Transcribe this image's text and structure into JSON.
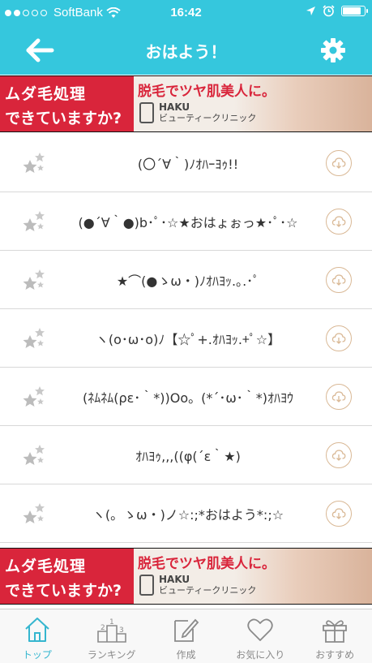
{
  "status_bar": {
    "carrier": "SoftBank",
    "time": "16:42",
    "battery_level": 0.9
  },
  "nav": {
    "title": "おはよう！",
    "back_icon": "arrow-left-icon",
    "settings_icon": "gear-icon"
  },
  "ad_banner": {
    "line1": "ムダ毛処理",
    "line2": "できていますか?",
    "headline": "脱毛でツヤ肌美人に。",
    "brand": "HAKU",
    "brand_sub": "ビューティークリニック"
  },
  "items": [
    {
      "text": "(〇´∀｀)ﾉｵﾊｰﾖｩ!!"
    },
    {
      "text": "(●´∀｀●)b･ﾟ･☆★おはょぉっ★･ﾟ･☆"
    },
    {
      "text": "★⌒(●ゝω・)ﾉｵﾊﾖｯ.｡.･ﾟ"
    },
    {
      "text": "ヽ(o･ω･o)ﾉ【☆ﾟ+.ｵﾊﾖｯ.+ﾟ☆】"
    },
    {
      "text": "(ﾈﾑﾈﾑ(ρε･｀*))Oo。(*´･ω･｀*)ｵﾊﾖｳ"
    },
    {
      "text": "ｵﾊﾖｩ,,,((φ(´ε｀★)"
    },
    {
      "text": "ヽ(。ゝω・)ノ☆:;*おはよう*:;☆"
    }
  ],
  "tabs": [
    {
      "label": "トップ",
      "icon": "home-icon",
      "active": true
    },
    {
      "label": "ランキング",
      "icon": "ranking-podium-icon",
      "active": false
    },
    {
      "label": "作成",
      "icon": "compose-icon",
      "active": false
    },
    {
      "label": "お気に入り",
      "icon": "heart-icon",
      "active": false
    },
    {
      "label": "おすすめ",
      "icon": "gift-icon",
      "active": false
    }
  ],
  "colors": {
    "accent": "#35c7dd",
    "tab_active": "#35b6cf",
    "banner_red": "#d9253b",
    "download_ring": "#d9b895"
  }
}
